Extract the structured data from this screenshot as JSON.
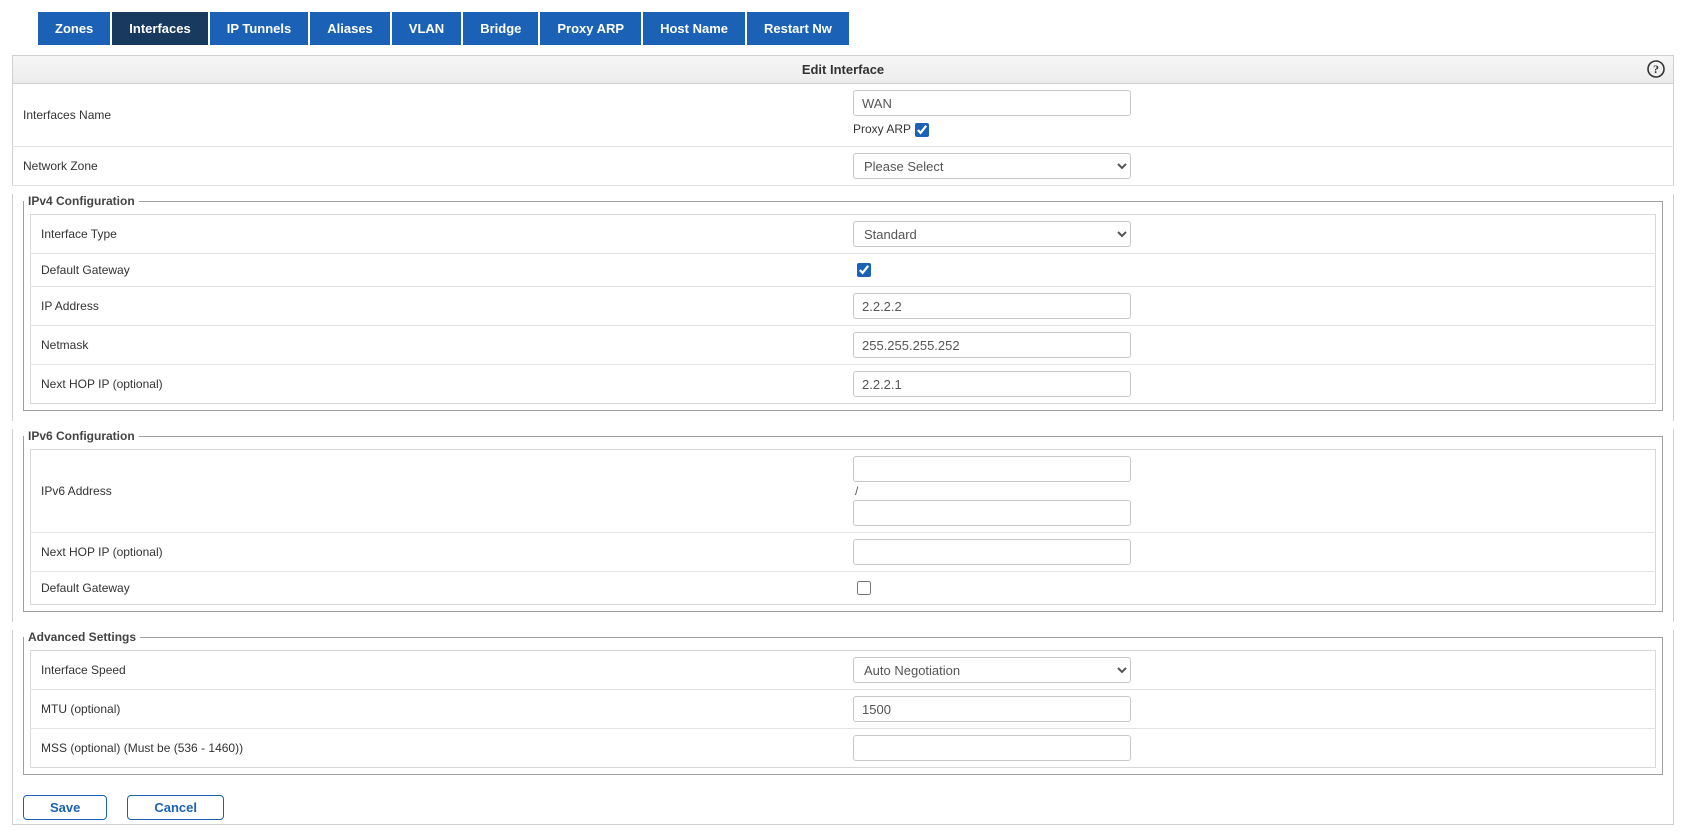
{
  "tabs": {
    "zones": "Zones",
    "interfaces": "Interfaces",
    "ip_tunnels": "IP Tunnels",
    "aliases": "Aliases",
    "vlan": "VLAN",
    "bridge": "Bridge",
    "proxy_arp": "Proxy ARP",
    "host_name": "Host Name",
    "restart_nw": "Restart Nw"
  },
  "title": "Edit Interface",
  "labels": {
    "interfaces_name": "Interfaces Name",
    "proxy_arp": "Proxy ARP",
    "network_zone": "Network Zone"
  },
  "values": {
    "interfaces_name": "WAN",
    "proxy_arp_checked": true,
    "network_zone": "Please Select"
  },
  "ipv4": {
    "legend": "IPv4 Configuration",
    "labels": {
      "interface_type": "Interface Type",
      "default_gateway": "Default Gateway",
      "ip_address": "IP Address",
      "netmask": "Netmask",
      "next_hop": "Next HOP IP (optional)"
    },
    "values": {
      "interface_type": "Standard",
      "default_gateway_checked": true,
      "ip_address": "2.2.2.2",
      "netmask": "255.255.255.252",
      "next_hop": "2.2.2.1"
    }
  },
  "ipv6": {
    "legend": "IPv6 Configuration",
    "labels": {
      "ipv6_address": "IPv6 Address",
      "next_hop": "Next HOP IP (optional)",
      "default_gateway": "Default Gateway"
    },
    "values": {
      "ipv6_address": "",
      "ipv6_prefix": "",
      "slash": "/",
      "next_hop": "",
      "default_gateway_checked": false
    }
  },
  "advanced": {
    "legend": "Advanced Settings",
    "labels": {
      "interface_speed": "Interface Speed",
      "mtu": "MTU (optional)",
      "mss": "MSS (optional) (Must be (536 - 1460))"
    },
    "values": {
      "interface_speed": "Auto Negotiation",
      "mtu": "1500",
      "mss": ""
    }
  },
  "buttons": {
    "save": "Save",
    "cancel": "Cancel"
  },
  "icons": {
    "help": "?"
  }
}
